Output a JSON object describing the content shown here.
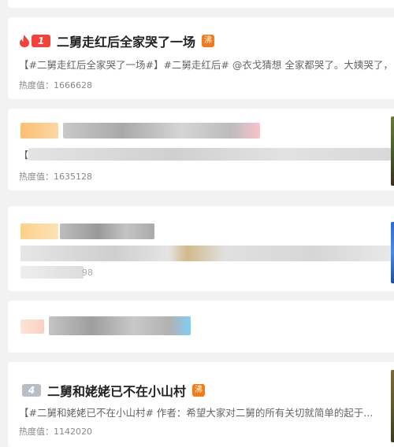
{
  "items": [
    {
      "rank": "1",
      "title": "二舅走红后全家哭了一场",
      "hot_tag": "沸",
      "desc": "【#二舅走红后全家哭了一场#】#二舅走红后# @衣戈猜想 全家都哭了。大姨哭了，",
      "heat_label": "热度值：",
      "heat_value": "1666628"
    },
    {
      "rank": "",
      "title": "",
      "desc": "【",
      "heat_label": "热度值：",
      "heat_value": "1635128"
    },
    {
      "rank": "",
      "title": "",
      "desc": "",
      "heat_label": "",
      "heat_value": "",
      "heat_partial": "98"
    },
    {
      "rank": "",
      "title": ""
    },
    {
      "rank": "4",
      "title": "二舅和姥姥已不在小山村",
      "hot_tag": "沸",
      "desc": "【#二舅和姥姥已不在小山村# 作者：希望大家对二舅的所有关切就简单的起于...",
      "heat_label": "热度值：",
      "heat_value": "1142020"
    }
  ],
  "icons": {
    "fire": "fire-icon"
  },
  "colors": {
    "rank_top": "#f4413a",
    "rank_other": "#b8bdc8",
    "hot_tag": "#f27c1b"
  }
}
